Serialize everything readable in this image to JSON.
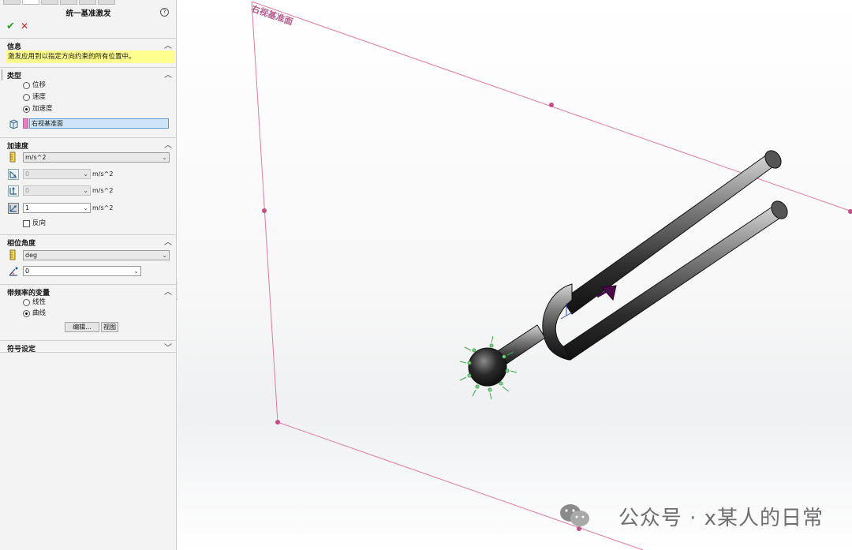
{
  "panel": {
    "title": "统一基准激发",
    "help": "?",
    "ok": "✔",
    "cancel": "✕",
    "info": {
      "header": "信息",
      "text": "激发应用到以指定方向约束的所有位置中。"
    },
    "type": {
      "header": "类型",
      "options": [
        "位移",
        "速度",
        "加速度"
      ],
      "selected": "加速度",
      "reference": "右视基准面"
    },
    "accel": {
      "header": "加速度",
      "unit_combo": "m/s^2",
      "rows": [
        {
          "value": "0",
          "unit": "m/s^2",
          "enabled": false
        },
        {
          "value": "0",
          "unit": "m/s^2",
          "enabled": false
        },
        {
          "value": "1",
          "unit": "m/s^2",
          "enabled": true
        }
      ],
      "reverse_label": "反向"
    },
    "phase": {
      "header": "相位角度",
      "unit_combo": "deg",
      "value": "0"
    },
    "freq": {
      "header": "带频率的变量",
      "options": [
        "线性",
        "曲线"
      ],
      "selected": "曲线",
      "edit_button": "编辑...",
      "view_button": "视图"
    },
    "symbol": {
      "header": "符号设定"
    }
  },
  "viewport": {
    "plane_label": "右视基准面",
    "watermark": "公众号 · x某人的日常",
    "colors": {
      "plane": "#e07aa6",
      "arrow": "#4a0a4a",
      "fixture": "#3aa84a"
    }
  }
}
